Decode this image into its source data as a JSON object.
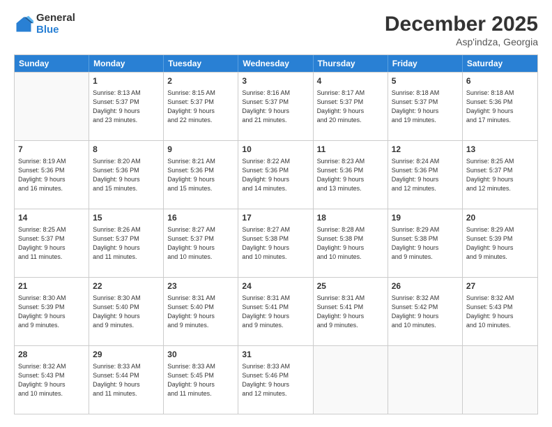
{
  "logo": {
    "general": "General",
    "blue": "Blue"
  },
  "title": "December 2025",
  "subtitle": "Asp'indza, Georgia",
  "header_days": [
    "Sunday",
    "Monday",
    "Tuesday",
    "Wednesday",
    "Thursday",
    "Friday",
    "Saturday"
  ],
  "weeks": [
    [
      {
        "day": "",
        "info": ""
      },
      {
        "day": "1",
        "info": "Sunrise: 8:13 AM\nSunset: 5:37 PM\nDaylight: 9 hours\nand 23 minutes."
      },
      {
        "day": "2",
        "info": "Sunrise: 8:15 AM\nSunset: 5:37 PM\nDaylight: 9 hours\nand 22 minutes."
      },
      {
        "day": "3",
        "info": "Sunrise: 8:16 AM\nSunset: 5:37 PM\nDaylight: 9 hours\nand 21 minutes."
      },
      {
        "day": "4",
        "info": "Sunrise: 8:17 AM\nSunset: 5:37 PM\nDaylight: 9 hours\nand 20 minutes."
      },
      {
        "day": "5",
        "info": "Sunrise: 8:18 AM\nSunset: 5:37 PM\nDaylight: 9 hours\nand 19 minutes."
      },
      {
        "day": "6",
        "info": "Sunrise: 8:18 AM\nSunset: 5:36 PM\nDaylight: 9 hours\nand 17 minutes."
      }
    ],
    [
      {
        "day": "7",
        "info": "Sunrise: 8:19 AM\nSunset: 5:36 PM\nDaylight: 9 hours\nand 16 minutes."
      },
      {
        "day": "8",
        "info": "Sunrise: 8:20 AM\nSunset: 5:36 PM\nDaylight: 9 hours\nand 15 minutes."
      },
      {
        "day": "9",
        "info": "Sunrise: 8:21 AM\nSunset: 5:36 PM\nDaylight: 9 hours\nand 15 minutes."
      },
      {
        "day": "10",
        "info": "Sunrise: 8:22 AM\nSunset: 5:36 PM\nDaylight: 9 hours\nand 14 minutes."
      },
      {
        "day": "11",
        "info": "Sunrise: 8:23 AM\nSunset: 5:36 PM\nDaylight: 9 hours\nand 13 minutes."
      },
      {
        "day": "12",
        "info": "Sunrise: 8:24 AM\nSunset: 5:36 PM\nDaylight: 9 hours\nand 12 minutes."
      },
      {
        "day": "13",
        "info": "Sunrise: 8:25 AM\nSunset: 5:37 PM\nDaylight: 9 hours\nand 12 minutes."
      }
    ],
    [
      {
        "day": "14",
        "info": "Sunrise: 8:25 AM\nSunset: 5:37 PM\nDaylight: 9 hours\nand 11 minutes."
      },
      {
        "day": "15",
        "info": "Sunrise: 8:26 AM\nSunset: 5:37 PM\nDaylight: 9 hours\nand 11 minutes."
      },
      {
        "day": "16",
        "info": "Sunrise: 8:27 AM\nSunset: 5:37 PM\nDaylight: 9 hours\nand 10 minutes."
      },
      {
        "day": "17",
        "info": "Sunrise: 8:27 AM\nSunset: 5:38 PM\nDaylight: 9 hours\nand 10 minutes."
      },
      {
        "day": "18",
        "info": "Sunrise: 8:28 AM\nSunset: 5:38 PM\nDaylight: 9 hours\nand 10 minutes."
      },
      {
        "day": "19",
        "info": "Sunrise: 8:29 AM\nSunset: 5:38 PM\nDaylight: 9 hours\nand 9 minutes."
      },
      {
        "day": "20",
        "info": "Sunrise: 8:29 AM\nSunset: 5:39 PM\nDaylight: 9 hours\nand 9 minutes."
      }
    ],
    [
      {
        "day": "21",
        "info": "Sunrise: 8:30 AM\nSunset: 5:39 PM\nDaylight: 9 hours\nand 9 minutes."
      },
      {
        "day": "22",
        "info": "Sunrise: 8:30 AM\nSunset: 5:40 PM\nDaylight: 9 hours\nand 9 minutes."
      },
      {
        "day": "23",
        "info": "Sunrise: 8:31 AM\nSunset: 5:40 PM\nDaylight: 9 hours\nand 9 minutes."
      },
      {
        "day": "24",
        "info": "Sunrise: 8:31 AM\nSunset: 5:41 PM\nDaylight: 9 hours\nand 9 minutes."
      },
      {
        "day": "25",
        "info": "Sunrise: 8:31 AM\nSunset: 5:41 PM\nDaylight: 9 hours\nand 9 minutes."
      },
      {
        "day": "26",
        "info": "Sunrise: 8:32 AM\nSunset: 5:42 PM\nDaylight: 9 hours\nand 10 minutes."
      },
      {
        "day": "27",
        "info": "Sunrise: 8:32 AM\nSunset: 5:43 PM\nDaylight: 9 hours\nand 10 minutes."
      }
    ],
    [
      {
        "day": "28",
        "info": "Sunrise: 8:32 AM\nSunset: 5:43 PM\nDaylight: 9 hours\nand 10 minutes."
      },
      {
        "day": "29",
        "info": "Sunrise: 8:33 AM\nSunset: 5:44 PM\nDaylight: 9 hours\nand 11 minutes."
      },
      {
        "day": "30",
        "info": "Sunrise: 8:33 AM\nSunset: 5:45 PM\nDaylight: 9 hours\nand 11 minutes."
      },
      {
        "day": "31",
        "info": "Sunrise: 8:33 AM\nSunset: 5:46 PM\nDaylight: 9 hours\nand 12 minutes."
      },
      {
        "day": "",
        "info": ""
      },
      {
        "day": "",
        "info": ""
      },
      {
        "day": "",
        "info": ""
      }
    ]
  ]
}
